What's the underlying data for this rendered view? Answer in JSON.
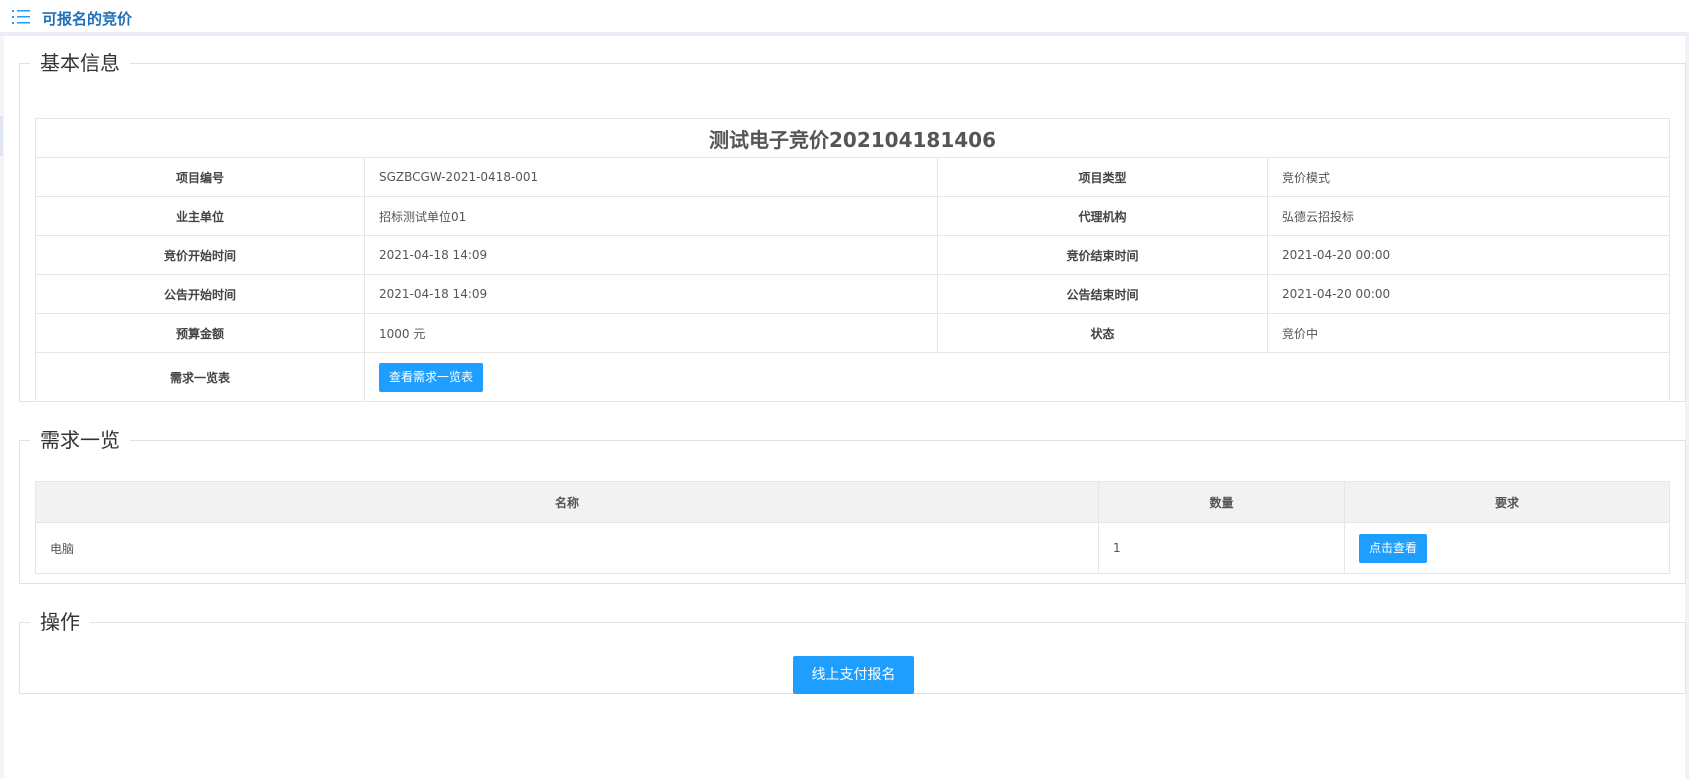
{
  "header": {
    "title": "可报名的竞价",
    "icon": "list-icon"
  },
  "basic": {
    "legend": "基本信息",
    "project_name": "测试电子竞价202104181406",
    "rows": [
      {
        "label1": "项目编号",
        "value1": "SGZBCGW-2021-0418-001",
        "label2": "项目类型",
        "value2": "竞价模式"
      },
      {
        "label1": "业主单位",
        "value1": "招标测试单位01",
        "label2": "代理机构",
        "value2": "弘德云招投标"
      },
      {
        "label1": "竞价开始时间",
        "value1": "2021-04-18 14:09",
        "label2": "竞价结束时间",
        "value2": "2021-04-20 00:00"
      },
      {
        "label1": "公告开始时间",
        "value1": "2021-04-18 14:09",
        "label2": "公告结束时间",
        "value2": "2021-04-20 00:00"
      },
      {
        "label1": "预算金额",
        "value1": "1000 元",
        "label2": "状态",
        "value2": "竞价中"
      }
    ],
    "req_label": "需求一览表",
    "req_button": "查看需求一览表"
  },
  "requirements": {
    "legend": "需求一览",
    "columns": [
      "名称",
      "数量",
      "要求"
    ],
    "rows": [
      {
        "name": "电脑",
        "qty": "1",
        "button": "点击查看"
      }
    ]
  },
  "operation": {
    "legend": "操作",
    "button": "线上支付报名"
  },
  "colors": {
    "accent": "#1e9fff",
    "title": "#1f6fb8"
  }
}
